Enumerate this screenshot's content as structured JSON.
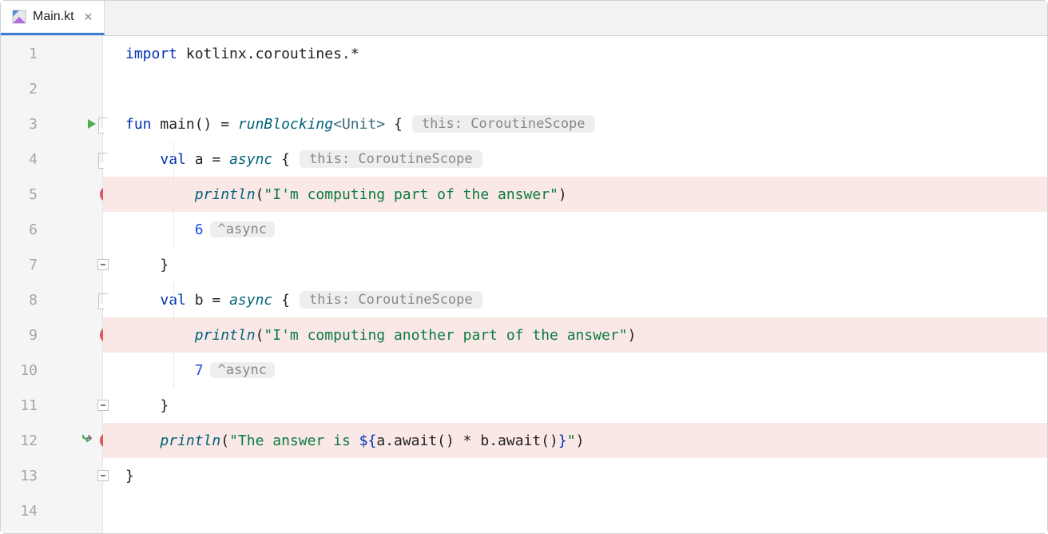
{
  "tab": {
    "filename": "Main.kt"
  },
  "hints": {
    "scope": "this: CoroutineScope",
    "asyncReturn": "^async"
  },
  "gutter": {
    "l1": "1",
    "l2": "2",
    "l3": "3",
    "l4": "4",
    "l5": "5",
    "l6": "6",
    "l7": "7",
    "l8": "8",
    "l9": "9",
    "l10": "10",
    "l11": "11",
    "l12": "12",
    "l13": "13",
    "l14": "14"
  },
  "code": {
    "line1": {
      "kw": "import",
      "rest": " kotlinx.coroutines.*"
    },
    "line3": {
      "fun": "fun",
      "name": " main() = ",
      "rb": "runBlocking",
      "gen": "<Unit>",
      "brace": " {"
    },
    "line4": {
      "pre": "    ",
      "val": "val",
      "mid": " a = ",
      "async": "async",
      "brace": " {"
    },
    "line5": {
      "pre": "        ",
      "fn": "println",
      "open": "(",
      "str": "\"I'm computing part of the answer\"",
      "close": ")"
    },
    "line6": {
      "pre": "        ",
      "num": "6"
    },
    "line7": {
      "pre": "    ",
      "brace": "}"
    },
    "line8": {
      "pre": "    ",
      "val": "val",
      "mid": " b = ",
      "async": "async",
      "brace": " {"
    },
    "line9": {
      "pre": "        ",
      "fn": "println",
      "open": "(",
      "str": "\"I'm computing another part of the answer\"",
      "close": ")"
    },
    "line10": {
      "pre": "        ",
      "num": "7"
    },
    "line11": {
      "pre": "    ",
      "brace": "}"
    },
    "line12": {
      "pre": "    ",
      "fn": "println",
      "open": "(",
      "s1": "\"The answer is ",
      "tmpl": "${",
      "expr": "a.await() * b.await()",
      "tmplc": "}",
      "s2": "\"",
      "close": ")"
    },
    "line13": {
      "brace": "}"
    }
  }
}
